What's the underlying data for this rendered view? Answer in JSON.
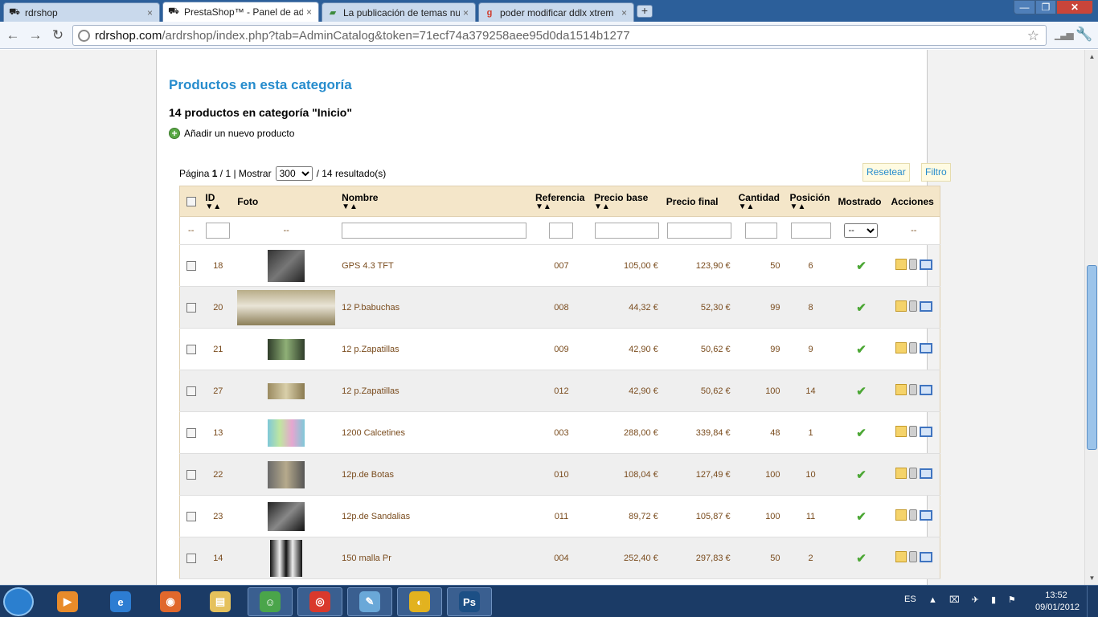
{
  "browser": {
    "tabs": [
      {
        "label": "rdrshop",
        "close": "×",
        "fav": "⛟"
      },
      {
        "label": "PrestaShop™ - Panel de adr",
        "close": "×",
        "fav": "⛟"
      },
      {
        "label": "La publicación de temas nu",
        "close": "×",
        "fav": "▰"
      },
      {
        "label": "poder modificar ddlx xtrem",
        "close": "×",
        "fav": "g"
      }
    ],
    "new_tab": "+",
    "url_host": "rdrshop.com",
    "url_path": "/ardrshop/index.php?tab=AdminCatalog&token=71ecf74a379258aee95d0da1514b1277",
    "window_controls": {
      "minimize": "—",
      "maximize": "❐",
      "close": "✕"
    },
    "nav": {
      "back": "←",
      "forward": "→",
      "reload": "↻",
      "star": "☆",
      "wrench": "🔧",
      "signal": "▁▃▅"
    }
  },
  "page": {
    "title": "Productos en esta categoría",
    "category_count": "14 productos en categoría \"Inicio\"",
    "add_product": "Añadir un nuevo producto",
    "pager": {
      "prefix": "Página",
      "page": "1",
      "of": "/",
      "total_pages": "1",
      "show": "| Mostrar",
      "per_page": "300",
      "results": "/ 14 resultado(s)"
    },
    "reset_label": "Resetear",
    "filter_label": "Filtro",
    "columns": {
      "id": "ID",
      "foto": "Foto",
      "nombre": "Nombre",
      "referencia": "Referencia",
      "precio_base": "Precio base",
      "precio_final": "Precio final",
      "cantidad": "Cantidad",
      "posicion": "Posición",
      "mostrado": "Mostrado",
      "acciones": "Acciones"
    },
    "sort_arrows": "▼▲",
    "filter_placeholder": "--",
    "mostrado_filter": "--",
    "products": [
      {
        "id": "18",
        "name": "GPS 4.3 TFT",
        "ref": "007",
        "base": "105,00 €",
        "final": "123,90 €",
        "qty": "50",
        "pos": "6",
        "thumb": "gps"
      },
      {
        "id": "20",
        "name": "12 P.babuchas",
        "ref": "008",
        "base": "44,32 €",
        "final": "52,30 €",
        "qty": "99",
        "pos": "8",
        "thumb": "babucha"
      },
      {
        "id": "21",
        "name": "12 p.Zapatillas",
        "ref": "009",
        "base": "42,90 €",
        "final": "50,62 €",
        "qty": "99",
        "pos": "9",
        "thumb": "zapatilla-verde"
      },
      {
        "id": "27",
        "name": "12 p.Zapatillas",
        "ref": "012",
        "base": "42,90 €",
        "final": "50,62 €",
        "qty": "100",
        "pos": "14",
        "thumb": "zapatilla-beige"
      },
      {
        "id": "13",
        "name": "1200 Calcetines",
        "ref": "003",
        "base": "288,00 €",
        "final": "339,84 €",
        "qty": "48",
        "pos": "1",
        "thumb": "calcetines"
      },
      {
        "id": "22",
        "name": "12p.de Botas",
        "ref": "010",
        "base": "108,04 €",
        "final": "127,49 €",
        "qty": "100",
        "pos": "10",
        "thumb": "botas"
      },
      {
        "id": "23",
        "name": "12p.de Sandalias",
        "ref": "011",
        "base": "89,72 €",
        "final": "105,87 €",
        "qty": "100",
        "pos": "11",
        "thumb": "sandalias"
      },
      {
        "id": "14",
        "name": "150 malla Pr",
        "ref": "004",
        "base": "252,40 €",
        "final": "297,83 €",
        "qty": "50",
        "pos": "2",
        "thumb": "malla"
      }
    ]
  },
  "taskbar": {
    "apps": [
      {
        "icon": "media-player-icon",
        "color": "#e88b2a",
        "glyph": "▶",
        "open": false
      },
      {
        "icon": "internet-explorer-icon",
        "color": "#2d7dd2",
        "glyph": "e",
        "open": false
      },
      {
        "icon": "firefox-icon",
        "color": "#e0682c",
        "glyph": "◉",
        "open": false
      },
      {
        "icon": "file-explorer-icon",
        "color": "#e5c15c",
        "glyph": "▤",
        "open": false
      },
      {
        "icon": "messenger-icon",
        "color": "#4aa54a",
        "glyph": "☺",
        "open": true
      },
      {
        "icon": "chrome-icon",
        "color": "#d9392c",
        "glyph": "◎",
        "open": true
      },
      {
        "icon": "paint-icon",
        "color": "#6aa8d8",
        "glyph": "✎",
        "open": true
      },
      {
        "icon": "ball-app-icon",
        "color": "#e2b21f",
        "glyph": "◐",
        "open": true
      },
      {
        "icon": "photoshop-icon",
        "color": "#1c4f85",
        "glyph": "Ps",
        "open": true
      }
    ],
    "lang": "ES",
    "tray": "▲ ⌧ ✈ ▮ ⚑",
    "time": "13:52",
    "date": "09/01/2012"
  }
}
